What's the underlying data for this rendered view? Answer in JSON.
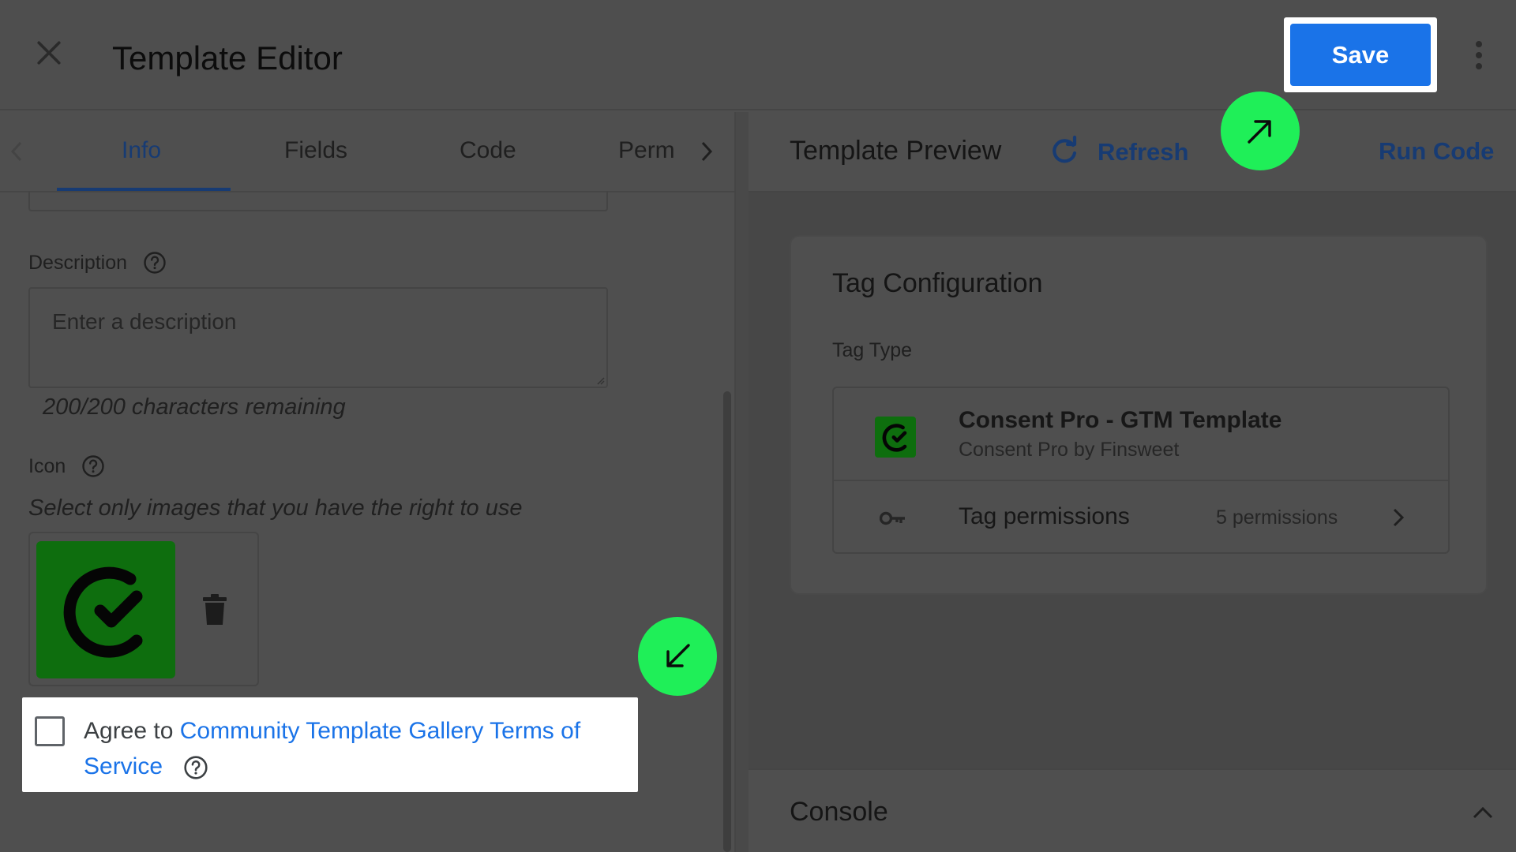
{
  "header": {
    "title": "Template Editor",
    "save_label": "Save"
  },
  "left": {
    "tabs": [
      {
        "label": "Info",
        "active": true
      },
      {
        "label": "Fields",
        "active": false
      },
      {
        "label": "Code",
        "active": false
      },
      {
        "label": "Perm",
        "active": false
      }
    ],
    "description": {
      "label": "Description",
      "placeholder": "Enter a description",
      "char_count": "200/200 characters remaining"
    },
    "icon": {
      "label": "Icon",
      "hint": "Select only images that you have the right to use"
    },
    "agree": {
      "prefix": "Agree to",
      "link_text": "Community Template Gallery Terms of Service",
      "checked": false
    }
  },
  "right": {
    "preview_title": "Template Preview",
    "refresh_label": "Refresh",
    "run_code_label": "Run Code",
    "tag_config": {
      "title": "Tag Configuration",
      "tag_type_label": "Tag Type",
      "tag_name": "Consent Pro - GTM Template",
      "tag_author": "Consent Pro by Finsweet",
      "permissions_label": "Tag permissions",
      "permissions_count": "5 permissions"
    },
    "console_label": "Console"
  },
  "icons": {
    "close": "close-icon",
    "more": "more-vert-icon",
    "refresh": "refresh-icon",
    "help": "help-icon",
    "delete": "trash-icon",
    "key": "key-icon",
    "chevron": "chevron-right-icon",
    "expand": "chevron-up-icon",
    "brand_logo": "check-mark-logo"
  },
  "colors": {
    "accent": "#1a73e8",
    "brand_green": "#0e6e0e",
    "marker_green": "#1fef58"
  }
}
